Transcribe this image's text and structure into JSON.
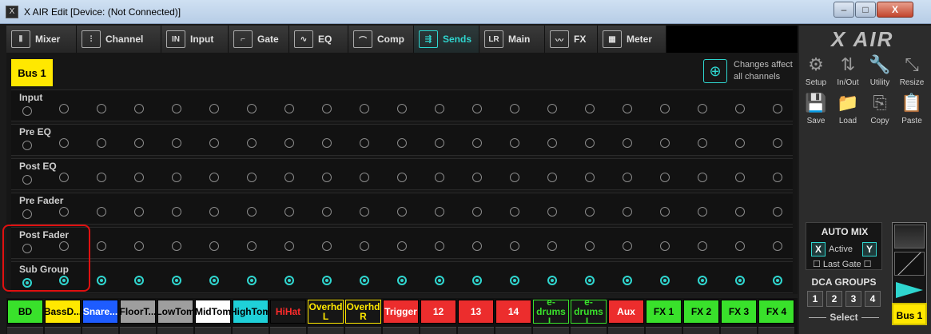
{
  "window": {
    "title": "X AIR Edit [Device: (Not Connected)]",
    "app_icon": "mixer-logo-icon",
    "controls": {
      "minimize": "–",
      "maximize": "□",
      "close": "X"
    }
  },
  "tabs": [
    {
      "label": "Mixer",
      "icon": "mixer-icon",
      "glyph": "⦀"
    },
    {
      "label": "Channel",
      "icon": "channel-icon",
      "glyph": "⫶"
    },
    {
      "label": "Input",
      "icon": "input-icon",
      "glyph": "IN"
    },
    {
      "label": "Gate",
      "icon": "gate-icon",
      "glyph": "⌐"
    },
    {
      "label": "EQ",
      "icon": "eq-icon",
      "glyph": "∿"
    },
    {
      "label": "Comp",
      "icon": "comp-icon",
      "glyph": "⌒"
    },
    {
      "label": "Sends",
      "icon": "sends-icon",
      "glyph": "⇶",
      "active": true
    },
    {
      "label": "Main",
      "icon": "main-icon",
      "glyph": "LR"
    },
    {
      "label": "FX",
      "icon": "fx-icon",
      "glyph": "〰"
    },
    {
      "label": "Meter",
      "icon": "meter-icon",
      "glyph": "▦"
    }
  ],
  "main": {
    "bus_badge": "Bus 1",
    "changes_note": "Changes affect all channels",
    "globe_icon": "globe-icon",
    "rows": [
      {
        "label": "Input",
        "selected_all": false
      },
      {
        "label": "Pre EQ",
        "selected_all": false
      },
      {
        "label": "Post EQ",
        "selected_all": false
      },
      {
        "label": "Pre Fader",
        "selected_all": false
      },
      {
        "label": "Post Fader",
        "selected_all": false
      },
      {
        "label": "Sub Group",
        "selected_all": true
      }
    ],
    "columns": 21
  },
  "channels": [
    {
      "label": "BD",
      "bg": "#39e12b",
      "fg": "#000000"
    },
    {
      "label": "BassD...",
      "bg": "#ffe800",
      "fg": "#000000"
    },
    {
      "label": "Snare...",
      "bg": "#1e5cff",
      "fg": "#ffffff"
    },
    {
      "label": "FloorT...",
      "bg": "#9e9e9e",
      "fg": "#000000"
    },
    {
      "label": "LowTom",
      "bg": "#9e9e9e",
      "fg": "#000000"
    },
    {
      "label": "MidTom",
      "bg": "#ffffff",
      "fg": "#000000"
    },
    {
      "label": "HighTom",
      "bg": "#1fd0d8",
      "fg": "#000000"
    },
    {
      "label": "HiHat",
      "bg": "#161616",
      "fg": "#ff2b2b"
    },
    {
      "label": "Overhd L",
      "bg": "#161616",
      "fg": "#ffe800",
      "outline": "#ffe800"
    },
    {
      "label": "Overhd R",
      "bg": "#161616",
      "fg": "#ffe800",
      "outline": "#ffe800"
    },
    {
      "label": "Trigger",
      "bg": "#ec2d2d",
      "fg": "#ffffff"
    },
    {
      "label": "12",
      "bg": "#ec2d2d",
      "fg": "#ffffff"
    },
    {
      "label": "13",
      "bg": "#ec2d2d",
      "fg": "#ffffff"
    },
    {
      "label": "14",
      "bg": "#ec2d2d",
      "fg": "#ffffff"
    },
    {
      "label": "e-drums L",
      "bg": "#161616",
      "fg": "#39e12b",
      "outline": "#39e12b"
    },
    {
      "label": "e-drums L",
      "bg": "#161616",
      "fg": "#39e12b",
      "outline": "#39e12b"
    },
    {
      "label": "Aux",
      "bg": "#ec2d2d",
      "fg": "#ffffff"
    },
    {
      "label": "FX 1",
      "bg": "#39e12b",
      "fg": "#000000"
    },
    {
      "label": "FX 2",
      "bg": "#39e12b",
      "fg": "#000000"
    },
    {
      "label": "FX 3",
      "bg": "#39e12b",
      "fg": "#000000"
    },
    {
      "label": "FX 4",
      "bg": "#39e12b",
      "fg": "#000000"
    }
  ],
  "right_panel": {
    "logo": "X AIR",
    "tools": [
      {
        "label": "Setup",
        "icon": "gears-icon",
        "glyph": "⚙"
      },
      {
        "label": "In/Out",
        "icon": "in-out-arrows-icon",
        "glyph": "⇅"
      },
      {
        "label": "Utility",
        "icon": "wrench-icon",
        "glyph": "🔧"
      },
      {
        "label": "Resize",
        "icon": "resize-icon",
        "glyph": "⤡"
      },
      {
        "label": "Save",
        "icon": "floppy-icon",
        "glyph": "💾"
      },
      {
        "label": "Load",
        "icon": "folder-icon",
        "glyph": "📁"
      },
      {
        "label": "Copy",
        "icon": "copy-icon",
        "glyph": "⎘"
      },
      {
        "label": "Paste",
        "icon": "paste-icon",
        "glyph": "📋"
      }
    ],
    "automix": {
      "title": "AUTO MIX",
      "x": "X",
      "active": "Active",
      "y": "Y",
      "last_gate": "Last Gate"
    },
    "dca_title": "DCA GROUPS",
    "dca_buttons": [
      "1",
      "2",
      "3",
      "4"
    ],
    "select_label": "Select",
    "bus_label": "Bus 1"
  },
  "colors": {
    "accent": "#2fd6cf",
    "highlight": "#e01010",
    "bus_yellow": "#ffe800"
  }
}
